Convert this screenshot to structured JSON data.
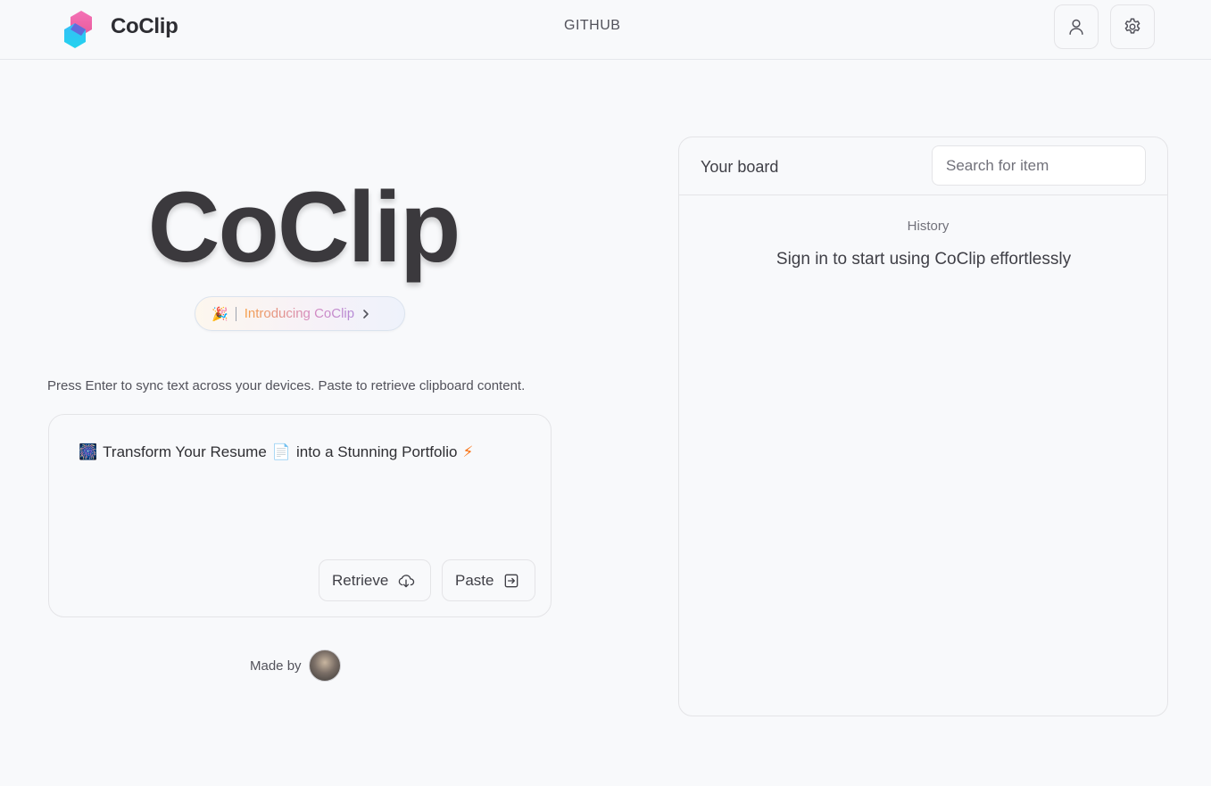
{
  "header": {
    "brand": "CoClip",
    "nav_github": "GITHUB",
    "icons": {
      "user": "user-icon",
      "settings": "gear-icon"
    }
  },
  "hero": {
    "title": "CoClip",
    "pill": {
      "emoji": "🎉",
      "label": "Introducing CoClip",
      "chevron": "chevron-right-icon"
    }
  },
  "editor": {
    "helper": "Press Enter to sync text across your devices. Paste to retrieve clipboard content.",
    "content": {
      "emoji_start": "🎆",
      "part1": "Transform Your Resume",
      "emoji_mid": "📄",
      "part2": "into a Stunning Portfolio",
      "emoji_end": "⚡"
    },
    "retrieve_label": "Retrieve",
    "paste_label": "Paste"
  },
  "footer": {
    "made_by": "Made by"
  },
  "board": {
    "title": "Your board",
    "search_placeholder": "Search for item",
    "history_label": "History",
    "empty_message": "Sign in to start using CoClip effortlessly"
  },
  "colors": {
    "background": "#f8f9fb",
    "border": "#e4e4e7",
    "logo_pink": "#f472b6",
    "logo_cyan": "#22d3ee",
    "title_text": "#3b393d"
  }
}
